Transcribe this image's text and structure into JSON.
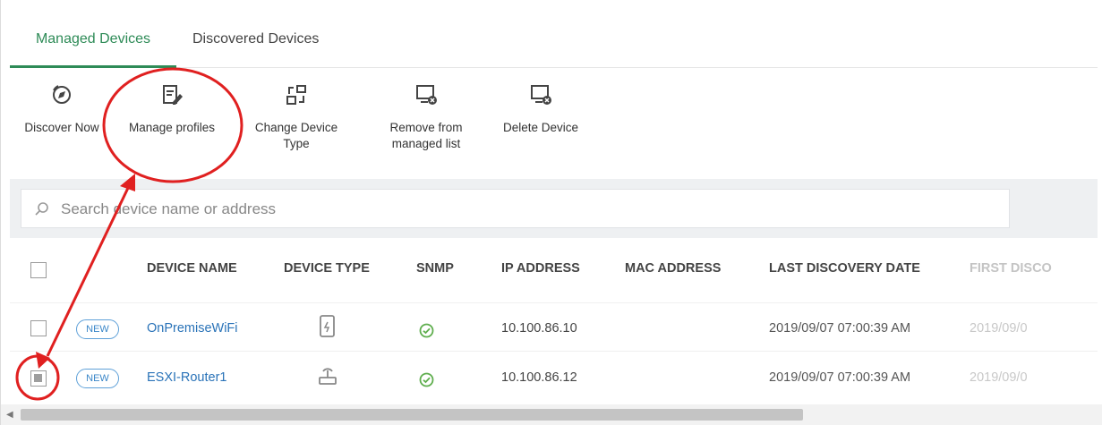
{
  "tabs": [
    {
      "label": "Managed Devices",
      "active": true
    },
    {
      "label": "Discovered Devices",
      "active": false
    }
  ],
  "toolbar": {
    "discover_now": "Discover Now",
    "manage_profiles": "Manage profiles",
    "change_device_type_1": "Change Device",
    "change_device_type_2": "Type",
    "remove_managed_1": "Remove from",
    "remove_managed_2": "managed list",
    "delete_device": "Delete Device"
  },
  "search": {
    "placeholder": "Search device name or address"
  },
  "table": {
    "headers": {
      "device_name": "DEVICE NAME",
      "device_type": "DEVICE TYPE",
      "snmp": "SNMP",
      "ip_address": "IP ADDRESS",
      "mac_address": "MAC ADDRESS",
      "last_discovery": "LAST DISCOVERY DATE",
      "first_discovery": "FIRST DISCO"
    },
    "rows": [
      {
        "badge": "NEW",
        "device_name": "OnPremiseWiFi",
        "device_type_icon": "wifi-device-icon",
        "snmp_icon": "check-circle-icon",
        "ip_address": "10.100.86.10",
        "mac_address": "",
        "last_discovery": "2019/09/07 07:00:39 AM",
        "first_discovery": "2019/09/0",
        "selected": false
      },
      {
        "badge": "NEW",
        "device_name": "ESXI-Router1",
        "device_type_icon": "router-icon",
        "snmp_icon": "check-circle-icon",
        "ip_address": "10.100.86.12",
        "mac_address": "",
        "last_discovery": "2019/09/07 07:00:39 AM",
        "first_discovery": "2019/09/0",
        "selected": true
      }
    ]
  },
  "colors": {
    "accent": "#2e8b57",
    "link": "#2a73b8",
    "annotation": "#e02020",
    "snmp_ok": "#5fae4e"
  }
}
